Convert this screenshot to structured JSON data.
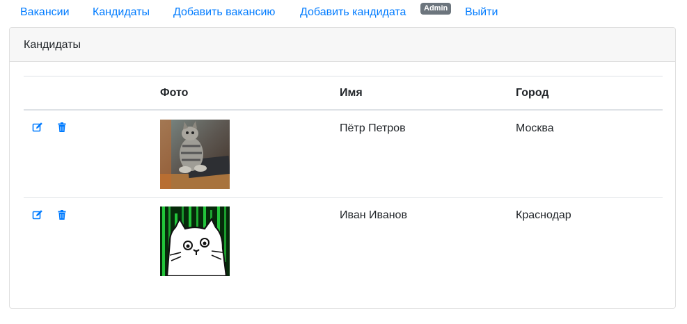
{
  "nav": {
    "vacancies": "Вакансии",
    "candidates": "Кандидаты",
    "add_vacancy": "Добавить вакансию",
    "add_candidate": "Добавить кандидата",
    "user_badge": "Admin",
    "logout": "Выйти"
  },
  "card": {
    "title": "Кандидаты"
  },
  "table": {
    "headers": [
      "",
      "Фото",
      "Имя",
      "Город"
    ],
    "rows": [
      {
        "name": "Пётр Петров",
        "city": "Москва",
        "photo_icon": "cat-at-keyboard-photo"
      },
      {
        "name": "Иван Иванов",
        "city": "Краснодар",
        "photo_icon": "cartoon-cat-matrix-photo"
      }
    ]
  },
  "colors": {
    "link": "#007bff",
    "badge_bg": "#6c757d",
    "header_bg": "#f7f7f7",
    "border": "#dee2e6"
  }
}
